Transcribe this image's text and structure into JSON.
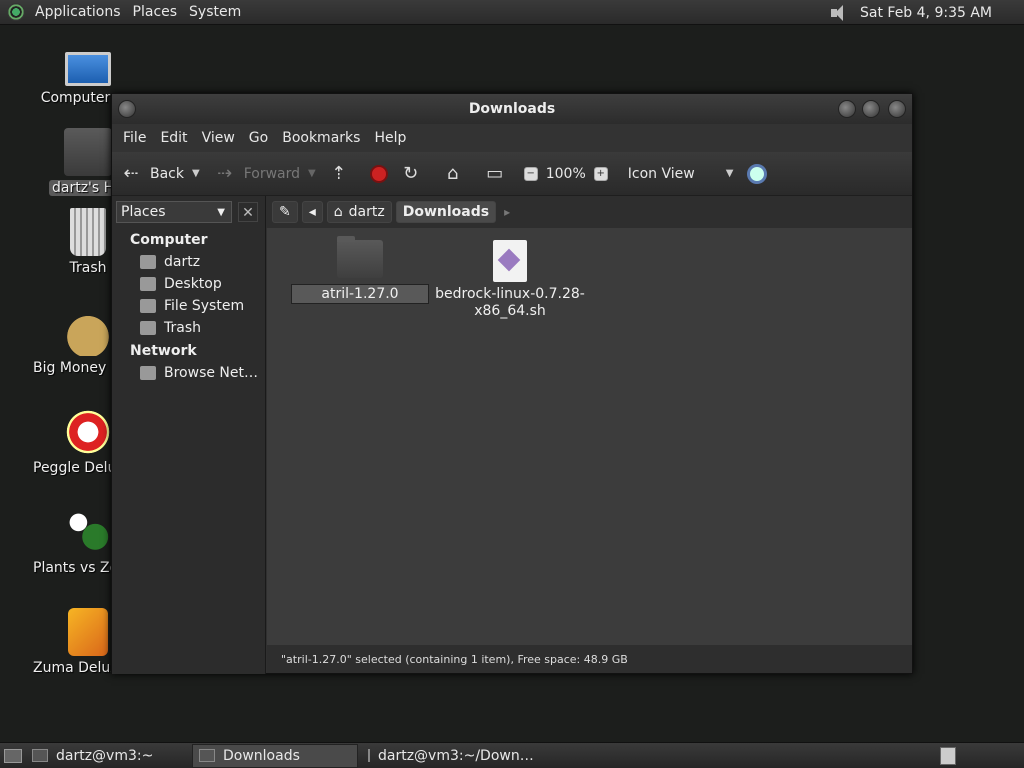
{
  "top_panel": {
    "menus": [
      "Applications",
      "Places",
      "System"
    ],
    "clock": "Sat Feb  4,  9:35 AM"
  },
  "desktop": {
    "icons": [
      {
        "label": "Computer"
      },
      {
        "label": "dartz's Home"
      },
      {
        "label": "Trash"
      },
      {
        "label": "Big Money Deluxe"
      },
      {
        "label": "Peggle Deluxe"
      },
      {
        "label": "Plants vs Zombies"
      },
      {
        "label": "Zuma Deluxe"
      }
    ]
  },
  "window": {
    "title": "Downloads",
    "menu": [
      "File",
      "Edit",
      "View",
      "Go",
      "Bookmarks",
      "Help"
    ],
    "toolbar": {
      "back": "Back",
      "forward": "Forward",
      "zoom": "100%",
      "view_mode": "Icon View"
    },
    "sidebar": {
      "combo": "Places",
      "sections": [
        {
          "title": "Computer",
          "items": [
            "dartz",
            "Desktop",
            "File System",
            "Trash"
          ]
        },
        {
          "title": "Network",
          "items": [
            "Browse Net…"
          ]
        }
      ]
    },
    "path": [
      "dartz",
      "Downloads"
    ],
    "files": [
      {
        "name": "atril-1.27.0",
        "type": "folder",
        "selected": true
      },
      {
        "name": "bedrock-linux-0.7.28-x86_64.sh",
        "name_line1": "bedrock-linux-0.7.28-",
        "name_line2": "x86_64.sh",
        "type": "script"
      }
    ],
    "status": "\"atril-1.27.0\" selected (containing 1 item), Free space: 48.9 GB"
  },
  "taskbar": {
    "tasks": [
      {
        "label": "dartz@vm3:~",
        "active": false
      },
      {
        "label": "Downloads",
        "active": true
      },
      {
        "label": "dartz@vm3:~/Down…",
        "active": false
      }
    ]
  }
}
